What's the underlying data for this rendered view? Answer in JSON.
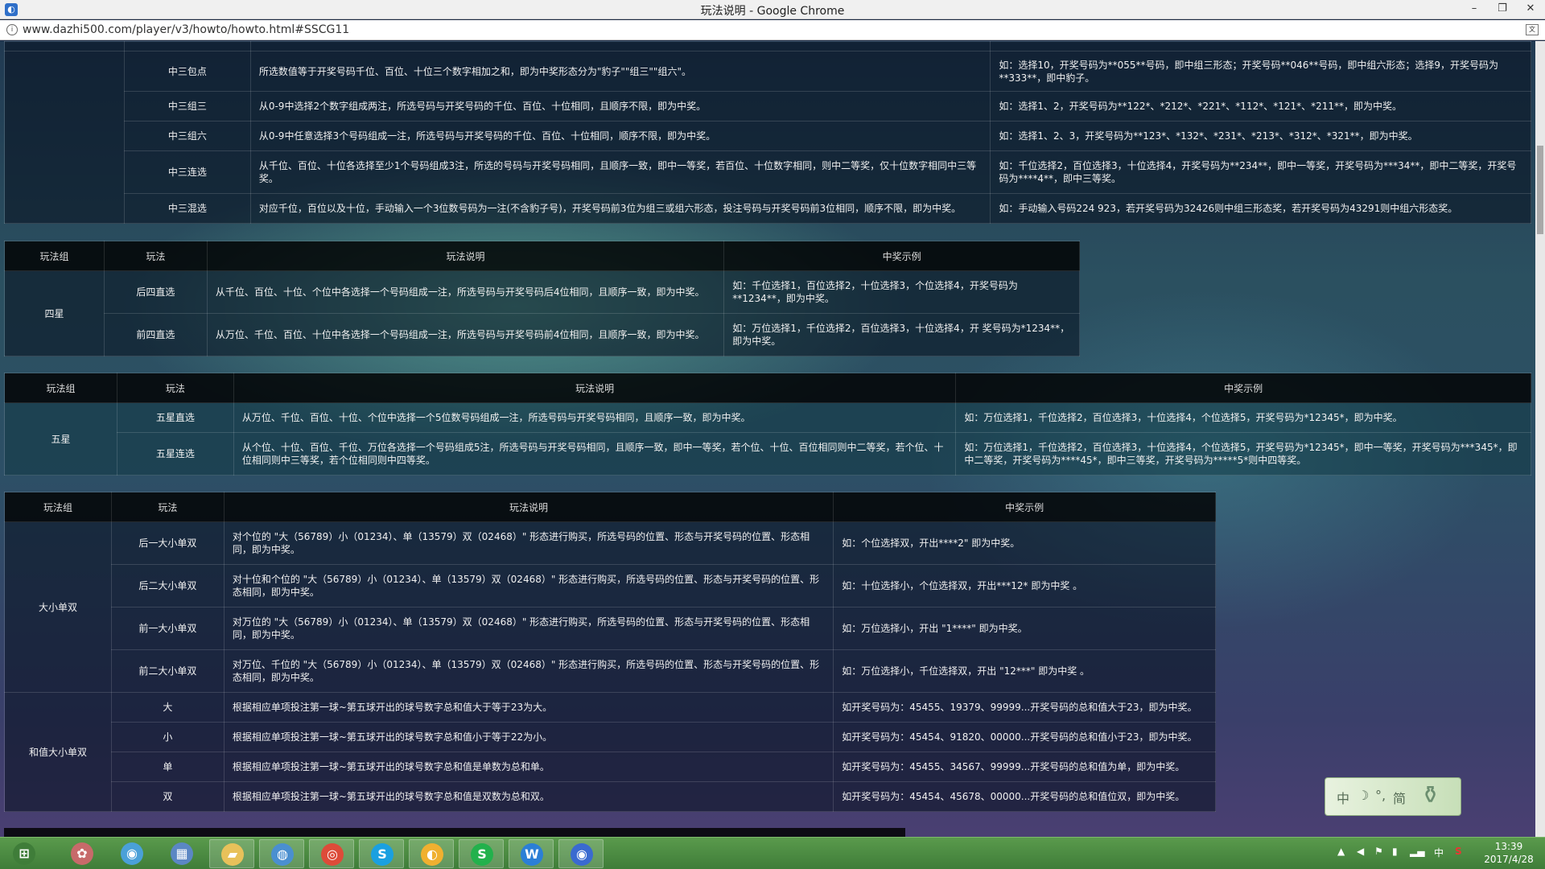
{
  "window": {
    "title": "玩法说明 - Google Chrome",
    "url": "www.dazhi500.com/player/v3/howto/howto.html#SSCG11",
    "minimize": "–",
    "restore": "❐",
    "close": "✕"
  },
  "headers": {
    "group": "玩法组",
    "play": "玩法",
    "desc": "玩法说明",
    "example": "中奖示例"
  },
  "table1": {
    "rows": [
      {
        "play": "中三包点",
        "desc": "所选数值等于开奖号码千位、百位、十位三个数字相加之和，即为中奖形态分为\"豹子\"\"组三\"\"组六\"。",
        "example": "如：选择10，开奖号码为**055**号码，即中组三形态；开奖号码**046**号码，即中组六形态；选择9，开奖号码为**333**，即中豹子。"
      },
      {
        "play": "中三组三",
        "desc": "从0-9中选择2个数字组成两注，所选号码与开奖号码的千位、百位、十位相同，且顺序不限，即为中奖。",
        "example": "如：选择1、2，开奖号码为**122*、*212*、*221*、*112*、*121*、*211**，即为中奖。"
      },
      {
        "play": "中三组六",
        "desc": "从0-9中任意选择3个号码组成一注，所选号码与开奖号码的千位、百位、十位相同，顺序不限，即为中奖。",
        "example": "如：选择1、2、3，开奖号码为**123*、*132*、*231*、*213*、*312*、*321**，即为中奖。"
      },
      {
        "play": "中三连选",
        "desc": "从千位、百位、十位各选择至少1个号码组成3注，所选的号码与开奖号码相同，且顺序一致，即中一等奖，若百位、十位数字相同，则中二等奖，仅十位数字相同中三等奖。",
        "example": "如：千位选择2，百位选择3，十位选择4，开奖号码为**234**，即中一等奖，开奖号码为***34**，即中二等奖，开奖号码为****4**，即中三等奖。"
      },
      {
        "play": "中三混选",
        "desc": "对应千位，百位以及十位，手动输入一个3位数号码为一注(不含豹子号)，开奖号码前3位为组三或组六形态，投注号码与开奖号码前3位相同，顺序不限，即为中奖。",
        "example": "如：手动输入号码224 923，若开奖号码为32426则中组三形态奖，若开奖号码为43291则中组六形态奖。"
      }
    ]
  },
  "table2": {
    "group": "四星",
    "rows": [
      {
        "play": "后四直选",
        "desc": "从千位、百位、十位、个位中各选择一个号码组成一注，所选号码与开奖号码后4位相同，且顺序一致，即为中奖。",
        "example": "如：千位选择1，百位选择2，十位选择3，个位选择4，开奖号码为**1234**，即为中奖。"
      },
      {
        "play": "前四直选",
        "desc": "从万位、千位、百位、十位中各选择一个号码组成一注，所选号码与开奖号码前4位相同，且顺序一致，即为中奖。",
        "example": "如：万位选择1，千位选择2，百位选择3，十位选择4，开 奖号码为*1234**，即为中奖。"
      }
    ]
  },
  "table3": {
    "group": "五星",
    "rows": [
      {
        "play": "五星直选",
        "desc": "从万位、千位、百位、十位、个位中选择一个5位数号码组成一注，所选号码与开奖号码相同，且顺序一致，即为中奖。",
        "example": "如：万位选择1，千位选择2，百位选择3，十位选择4，个位选择5，开奖号码为*12345*，即为中奖。"
      },
      {
        "play": "五星连选",
        "desc": "从个位、十位、百位、千位、万位各选择一个号码组成5注，所选号码与开奖号码相同，且顺序一致，即中一等奖，若个位、十位、百位相同则中二等奖，若个位、十位相同则中三等奖，若个位相同则中四等奖。",
        "example": "如：万位选择1，千位选择2，百位选择3，十位选择4，个位选择5，开奖号码为*12345*，即中一等奖，开奖号码为***345*，即中二等奖，开奖号码为****45*，即中三等奖，开奖号码为*****5*则中四等奖。"
      }
    ]
  },
  "table4": {
    "group_a": "大小单双",
    "group_b": "和值大小单双",
    "rows_a": [
      {
        "play": "后一大小单双",
        "desc": "对个位的 \"大（56789）小（01234）、单（13579）双（02468）\" 形态进行购买，所选号码的位置、形态与开奖号码的位置、形态相同，即为中奖。",
        "example": "如：个位选择双，开出****2\" 即为中奖。"
      },
      {
        "play": "后二大小单双",
        "desc": "对十位和个位的 \"大（56789）小（01234）、单（13579）双（02468）\" 形态进行购买，所选号码的位置、形态与开奖号码的位置、形态相同，即为中奖。",
        "example": "如：十位选择小，个位选择双，开出***12* 即为中奖 。"
      },
      {
        "play": "前一大小单双",
        "desc": "对万位的 \"大（56789）小（01234）、单（13579）双（02468）\" 形态进行购买，所选号码的位置、形态与开奖号码的位置、形态相同，即为中奖。",
        "example": "如：万位选择小，开出 \"1****\" 即为中奖。"
      },
      {
        "play": "前二大小单双",
        "desc": "对万位、千位的 \"大（56789）小（01234）、单（13579）双（02468）\" 形态进行购买，所选号码的位置、形态与开奖号码的位置、形态相同，即为中奖。",
        "example": "如：万位选择小，千位选择双，开出 \"12***\" 即为中奖 。"
      }
    ],
    "rows_b": [
      {
        "play": "大",
        "desc": "根据相应单项投注第一球~第五球开出的球号数字总和值大于等于23为大。",
        "example": "如开奖号码为：45455、19379、99999...开奖号码的总和值大于23，即为中奖。"
      },
      {
        "play": "小",
        "desc": "根据相应单项投注第一球~第五球开出的球号数字总和值小于等于22为小。",
        "example": "如开奖号码为：45454、91820、00000...开奖号码的总和值小于23，即为中奖。"
      },
      {
        "play": "单",
        "desc": "根据相应单项投注第一球~第五球开出的球号数字总和值是单数为总和单。",
        "example": "如开奖号码为：45455、34567、99999...开奖号码的总和值为单，即为中奖。"
      },
      {
        "play": "双",
        "desc": "根据相应单项投注第一球~第五球开出的球号数字总和值是双数为总和双。",
        "example": "如开奖号码为：45454、45678、00000...开奖号码的总和值位双，即为中奖。"
      }
    ]
  },
  "ime": {
    "lang": "中",
    "width": "简"
  },
  "taskbar": {
    "items": [
      {
        "name": "start-icon",
        "glyph": "⊞",
        "color": "#3f7d39"
      },
      {
        "name": "bird-icon",
        "glyph": "✿",
        "color": "#c76a6a"
      },
      {
        "name": "globe-icon",
        "glyph": "◉",
        "color": "#4aa0d8"
      },
      {
        "name": "calculator-icon",
        "glyph": "▦",
        "color": "#5b87c4"
      },
      {
        "name": "folder-icon",
        "glyph": "▰",
        "color": "#e8c15a"
      },
      {
        "name": "network-icon",
        "glyph": "◍",
        "color": "#4a8fd0"
      },
      {
        "name": "chrome-icon",
        "glyph": "◎",
        "color": "#dd4b39"
      },
      {
        "name": "skype-icon",
        "glyph": "S",
        "color": "#1aa0e0"
      },
      {
        "name": "paint-icon",
        "glyph": "◐",
        "color": "#f0b030"
      },
      {
        "name": "sheets-icon",
        "glyph": "S",
        "color": "#22b14c"
      },
      {
        "name": "word-icon",
        "glyph": "W",
        "color": "#2b7fd6"
      },
      {
        "name": "firefox-icon",
        "glyph": "◉",
        "color": "#3a6ad0"
      }
    ],
    "tray_lang": "中",
    "time": "13:39",
    "date": "2017/4/28"
  }
}
